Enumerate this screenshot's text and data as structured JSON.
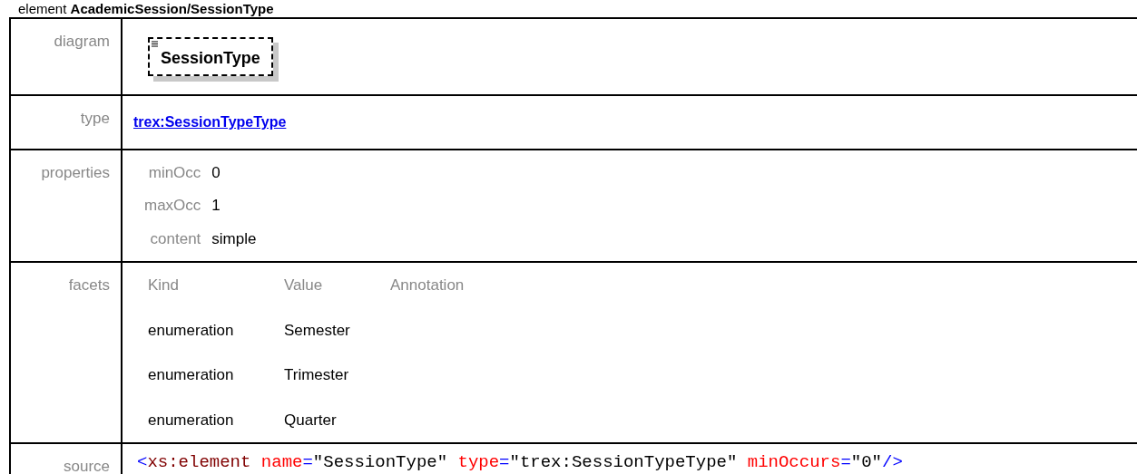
{
  "heading": {
    "label": "element",
    "path": "AcademicSession/SessionType"
  },
  "rows": [
    {
      "kind": "diagram",
      "label": "diagram",
      "node": "SessionType"
    },
    {
      "kind": "link",
      "label": "type",
      "value": "trex:SessionTypeType"
    },
    {
      "kind": "pairs",
      "label": "properties",
      "pairs": [
        {
          "key": "minOcc",
          "value": "0"
        },
        {
          "key": "maxOcc",
          "value": "1"
        },
        {
          "key": "content",
          "value": "simple"
        }
      ]
    },
    {
      "kind": "table",
      "label": "facets",
      "columns": [
        "Kind",
        "Value",
        "Annotation"
      ],
      "rows": [
        [
          "enumeration",
          "Semester"
        ],
        [
          "enumeration",
          "Trimester"
        ],
        [
          "enumeration",
          "Quarter"
        ]
      ]
    },
    {
      "kind": "code",
      "label": "source",
      "tokens": [
        {
          "text": "<",
          "kind": "punct"
        },
        {
          "text": "xs:element",
          "kind": "element"
        },
        {
          "text": " name",
          "kind": "attr"
        },
        {
          "text": "=",
          "kind": "punct"
        },
        {
          "text": "\"SessionType\"",
          "kind": "value"
        },
        {
          "text": " type",
          "kind": "attr"
        },
        {
          "text": "=",
          "kind": "punct"
        },
        {
          "text": "\"trex:SessionTypeType\"",
          "kind": "value"
        },
        {
          "text": " minOccurs",
          "kind": "attr"
        },
        {
          "text": "=",
          "kind": "punct"
        },
        {
          "text": "\"0\"",
          "kind": "value"
        },
        {
          "text": "/>",
          "kind": "punct"
        }
      ]
    }
  ]
}
